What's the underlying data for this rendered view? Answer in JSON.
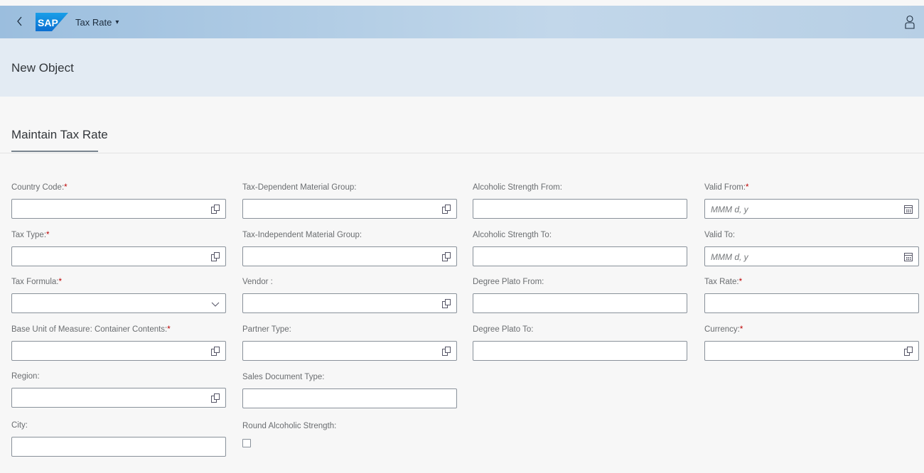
{
  "shell": {
    "back_icon": "chevron-left-icon",
    "logo": "SAP",
    "app_title": "Tax Rate",
    "app_title_caret": "▾",
    "user_icon": "person-icon"
  },
  "header": {
    "title": "New Object"
  },
  "section": {
    "title": "Maintain Tax Rate"
  },
  "fields": {
    "country_code": {
      "label": "Country Code:",
      "required": "*",
      "value": ""
    },
    "tax_type": {
      "label": "Tax Type:",
      "required": "*",
      "value": ""
    },
    "tax_formula": {
      "label": "Tax Formula:",
      "required": "*",
      "value": ""
    },
    "base_uom": {
      "label": "Base Unit of Measure: Container Contents:",
      "required": "*",
      "value": ""
    },
    "region": {
      "label": "Region:",
      "value": ""
    },
    "city": {
      "label": "City:",
      "value": ""
    },
    "tax_dep_group": {
      "label": "Tax-Dependent Material Group:",
      "value": ""
    },
    "tax_indep_group": {
      "label": "Tax-Independent Material Group:",
      "value": ""
    },
    "vendor": {
      "label": "Vendor :",
      "value": ""
    },
    "partner_type": {
      "label": "Partner Type:",
      "value": ""
    },
    "sales_doc_type": {
      "label": "Sales Document Type:",
      "value": ""
    },
    "round_alc": {
      "label": "Round Alcoholic Strength:",
      "checked": false
    },
    "alc_from": {
      "label": "Alcoholic Strength From:",
      "value": ""
    },
    "alc_to": {
      "label": "Alcoholic Strength To:",
      "value": ""
    },
    "plato_from": {
      "label": "Degree Plato From:",
      "value": ""
    },
    "plato_to": {
      "label": "Degree Plato To:",
      "value": ""
    },
    "valid_from": {
      "label": "Valid From:",
      "required": "*",
      "placeholder": "MMM d, y"
    },
    "valid_to": {
      "label": "Valid To:",
      "placeholder": "MMM d, y"
    },
    "tax_rate": {
      "label": "Tax Rate:",
      "required": "*",
      "value": ""
    },
    "currency": {
      "label": "Currency:",
      "required": "*",
      "value": ""
    }
  },
  "icons": {
    "value_help": "value-help-icon",
    "calendar": "calendar-icon",
    "dropdown": "chevron-down-icon"
  },
  "colors": {
    "shell_bar": "#9bbede",
    "object_header": "#e3ebf3",
    "required": "#bb0000",
    "sap_logo": "#0a6ed1"
  }
}
